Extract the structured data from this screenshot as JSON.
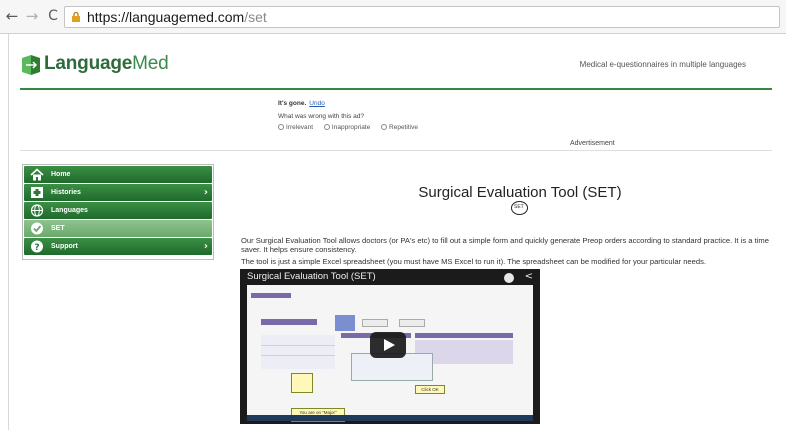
{
  "browser": {
    "url_host": "https://languagemed.com",
    "url_path": "/set"
  },
  "header": {
    "logo_bold": "Language",
    "logo_regular": "Med",
    "tagline": "Medical e-questionnaires in multiple languages",
    "brand_color": "#2f8a44"
  },
  "ad": {
    "gone_text": "It's gone.",
    "undo_label": "Undo",
    "question": "What was wrong with this ad?",
    "options": [
      "Irrelevant",
      "Inappropriate",
      "Repetitive"
    ],
    "advert_label": "Advertisement"
  },
  "sidebar": {
    "items": [
      {
        "label": "Home",
        "icon": "home-icon"
      },
      {
        "label": "Histories",
        "icon": "medical-cross-icon"
      },
      {
        "label": "Languages",
        "icon": "globe-icon"
      },
      {
        "label": "SET",
        "icon": "check-icon"
      },
      {
        "label": "Support",
        "icon": "question-icon"
      }
    ]
  },
  "main": {
    "title": "Surgical Evaluation Tool (SET)",
    "intro": "Our Surgical Evaluation Tool allows doctors (or PA's etc) to fill out a simple form and quickly generate Preop orders according to standard practice.  It is a time saver. It helps ensure consistency.",
    "tool_note": "The tool is just a simple Excel spreadsheet (you must have MS Excel to run it).  The spreadsheet can be modified for your particular needs."
  },
  "video": {
    "title": "Surgical Evaluation Tool (SET)",
    "callout_click": "Click OK",
    "callout_page": "You are on \"Major\" page"
  }
}
